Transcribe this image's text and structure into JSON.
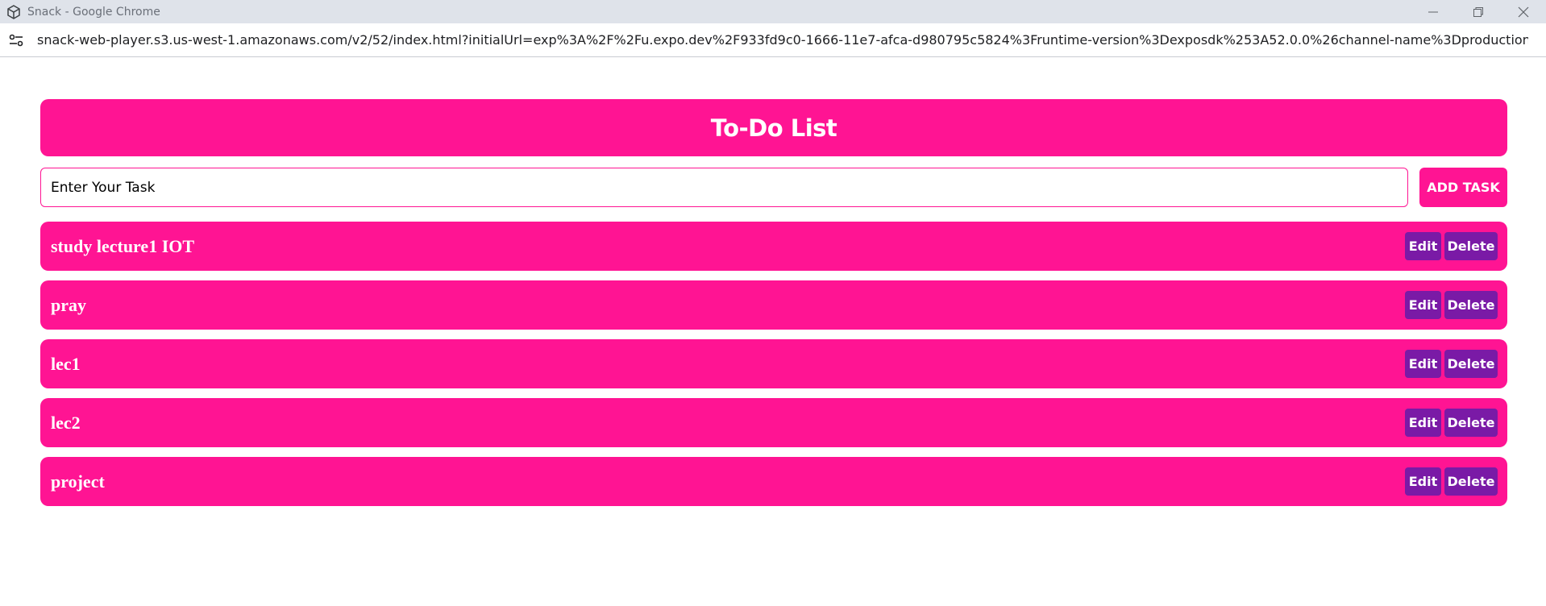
{
  "window": {
    "title": "Snack - Google Chrome"
  },
  "browser": {
    "url": "snack-web-player.s3.us-west-1.amazonaws.com/v2/52/index.html?initialUrl=exp%3A%2F%2Fu.expo.dev%2F933fd9c0-1666-11e7-afca-d980795c5824%3Fruntime-version%3Dexposdk%253A52.0.0%26channel-name%3Dproduction%26sna..."
  },
  "app": {
    "title": "To-Do List",
    "input": {
      "value": "",
      "placeholder": "Enter Your Task"
    },
    "add_button_label": "ADD TASK",
    "edit_label": "Edit",
    "delete_label": "Delete",
    "tasks": [
      "study lecture1 IOT",
      "pray",
      "lec1",
      "lec2",
      "project"
    ]
  },
  "colors": {
    "primary_pink": "#ff1493",
    "button_purple": "#7a1aa6",
    "titlebar": "#dfe3ea"
  },
  "icons": {
    "app_icon": "cube-icon",
    "site_info": "tune-icon",
    "minimize": "minimize-icon",
    "restore": "restore-icon",
    "close": "close-icon"
  }
}
